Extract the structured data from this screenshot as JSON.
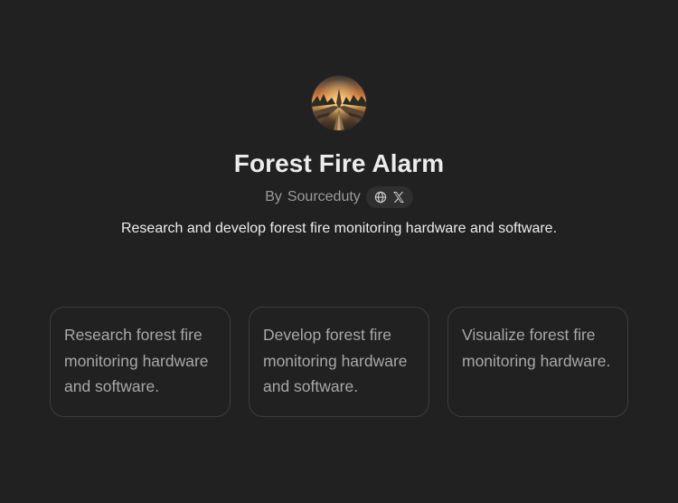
{
  "gpt": {
    "name": "Forest Fire Alarm",
    "author_prefix": "By",
    "author": "Sourceduty",
    "description": "Research and develop forest fire monitoring hardware and software.",
    "avatar_icon": "forest-fire-avatar",
    "social_icons": [
      "globe-icon",
      "x-icon"
    ]
  },
  "conversation_starters": [
    {
      "text": "Research forest fire monitoring hardware and software."
    },
    {
      "text": "Develop forest fire monitoring hardware and software."
    },
    {
      "text": "Visualize forest fire monitoring hardware."
    }
  ],
  "colors": {
    "background": "#212121",
    "title": "#ececec",
    "muted": "#9b9b9b",
    "card_border": "#3d3d3d",
    "pill": "#2f2f2f"
  }
}
